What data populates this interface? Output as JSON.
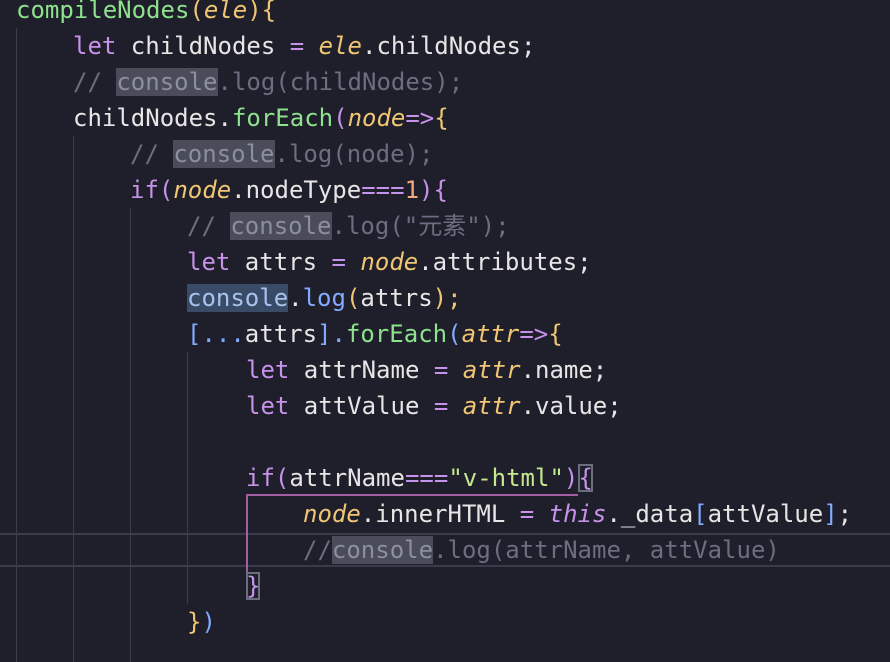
{
  "code": {
    "l1": {
      "fn": "compileNodes",
      "open": "(",
      "param": "ele",
      "close": ")",
      "brace": "{"
    },
    "l2": {
      "kw": "let",
      "name": " childNodes ",
      "eq": "=",
      "sp": " ",
      "obj": "ele",
      "prop": ".childNodes;"
    },
    "l3": {
      "slashes": "// ",
      "cons": "console",
      "rest": ".log(childNodes);"
    },
    "l4": {
      "name": "childNodes.",
      "fn": "forEach",
      "open": "(",
      "param": "node",
      "arrow": "=>",
      "brace": "{"
    },
    "l5": {
      "slashes": "// ",
      "cons": "console",
      "rest": ".log(node);"
    },
    "l6": {
      "kw": "if",
      "open": "(",
      "param": "node",
      "prop": ".nodeType",
      "op": "===",
      "num": "1",
      "close": ")",
      "brace": "{"
    },
    "l7": {
      "slashes": "// ",
      "cons": "console",
      "rest": ".log(\"元素\");"
    },
    "l8": {
      "kw": "let",
      "name": " attrs ",
      "eq": "=",
      "sp": " ",
      "obj": "node",
      "prop": ".attributes;"
    },
    "l9": {
      "cons": "console",
      "dot": ".",
      "fn": "log",
      "open": "(",
      "arg": "attrs",
      "close": ");"
    },
    "l10": {
      "open": "[...",
      "name": "attrs",
      "close": "].",
      "fn": "forEach",
      "paren": "(",
      "param": "attr",
      "arrow": "=>",
      "brace": "{"
    },
    "l11": {
      "kw": "let",
      "name": " attrName ",
      "eq": "=",
      "sp": " ",
      "obj": "attr",
      "prop": ".name;"
    },
    "l12": {
      "kw": "let",
      "name": " attValue ",
      "eq": "=",
      "sp": " ",
      "obj": "attr",
      "prop": ".value;"
    },
    "l14": {
      "kw": "if",
      "open": "(",
      "name": "attrName",
      "op": "===",
      "str": "\"v-html\"",
      "close": ")",
      "brace": "{"
    },
    "l15": {
      "obj": "node",
      "prop": ".innerHTML ",
      "eq": "=",
      "sp": " ",
      "this": "this",
      "rest": "._data",
      "lb": "[",
      "key": "attValue",
      "rb": "]",
      "semi": ";"
    },
    "l16": {
      "slashes": "//",
      "cons": "console",
      "rest": ".log(attrName, attValue)"
    },
    "l17": {
      "brace": "}"
    },
    "l18": {
      "brace": "}",
      "paren": ")"
    }
  }
}
